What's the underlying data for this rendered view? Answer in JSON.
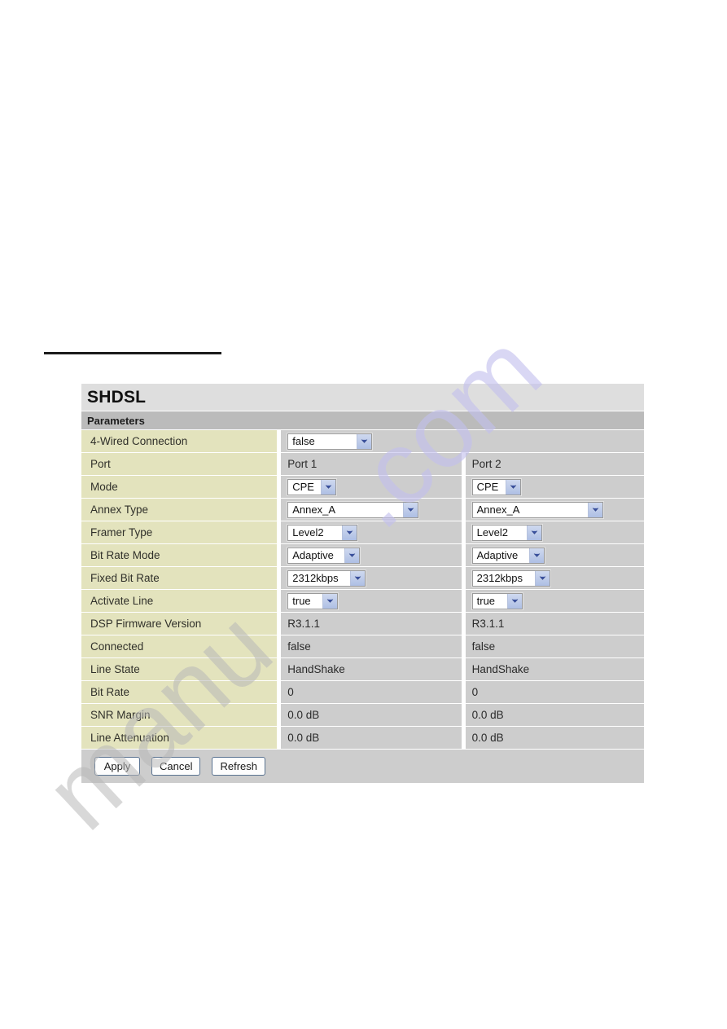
{
  "page": {
    "watermark_left": "manu",
    "watermark_right": ".com"
  },
  "panel": {
    "title": "SHDSL",
    "section_header": "Parameters"
  },
  "rows": [
    {
      "label": "4-Wired Connection",
      "type": "select-span",
      "value": "false",
      "width_class": "w-false"
    },
    {
      "label": "Port",
      "type": "text",
      "port1": "Port 1",
      "port2": "Port 2"
    },
    {
      "label": "Mode",
      "type": "select",
      "port1": "CPE",
      "port2": "CPE",
      "width_class": "w-cpe"
    },
    {
      "label": "Annex Type",
      "type": "select",
      "port1": "Annex_A",
      "port2": "Annex_A",
      "width_class": "w-annex"
    },
    {
      "label": "Framer Type",
      "type": "select",
      "port1": "Level2",
      "port2": "Level2",
      "width_class": "w-level"
    },
    {
      "label": "Bit Rate Mode",
      "type": "select",
      "port1": "Adaptive",
      "port2": "Adaptive",
      "width_class": "w-adapt"
    },
    {
      "label": "Fixed Bit Rate",
      "type": "select",
      "port1": "2312kbps",
      "port2": "2312kbps",
      "width_class": "w-rate"
    },
    {
      "label": "Activate Line",
      "type": "select",
      "port1": "true",
      "port2": "true",
      "width_class": "w-true"
    },
    {
      "label": "DSP Firmware Version",
      "type": "text",
      "port1": "R3.1.1",
      "port2": "R3.1.1"
    },
    {
      "label": "Connected",
      "type": "text",
      "port1": "false",
      "port2": "false"
    },
    {
      "label": "Line State",
      "type": "text",
      "port1": "HandShake",
      "port2": "HandShake"
    },
    {
      "label": "Bit Rate",
      "type": "text",
      "port1": "0",
      "port2": "0"
    },
    {
      "label": "SNR Margin",
      "type": "text",
      "port1": "0.0 dB",
      "port2": "0.0 dB"
    },
    {
      "label": "Line Attenuation",
      "type": "text",
      "port1": "0.0 dB",
      "port2": "0.0 dB"
    }
  ],
  "footer": {
    "apply_label": "Apply",
    "cancel_label": "Cancel",
    "refresh_label": "Refresh"
  },
  "colors": {
    "label_cell": "#e3e3bd",
    "value_cell": "#cdcdcd",
    "title_bar": "#dedede",
    "section_bar": "#bbbbbb",
    "select_button": "#aebfe4",
    "watermark_purple": "#c3c0ee",
    "watermark_gray": "#b9b9b9"
  }
}
